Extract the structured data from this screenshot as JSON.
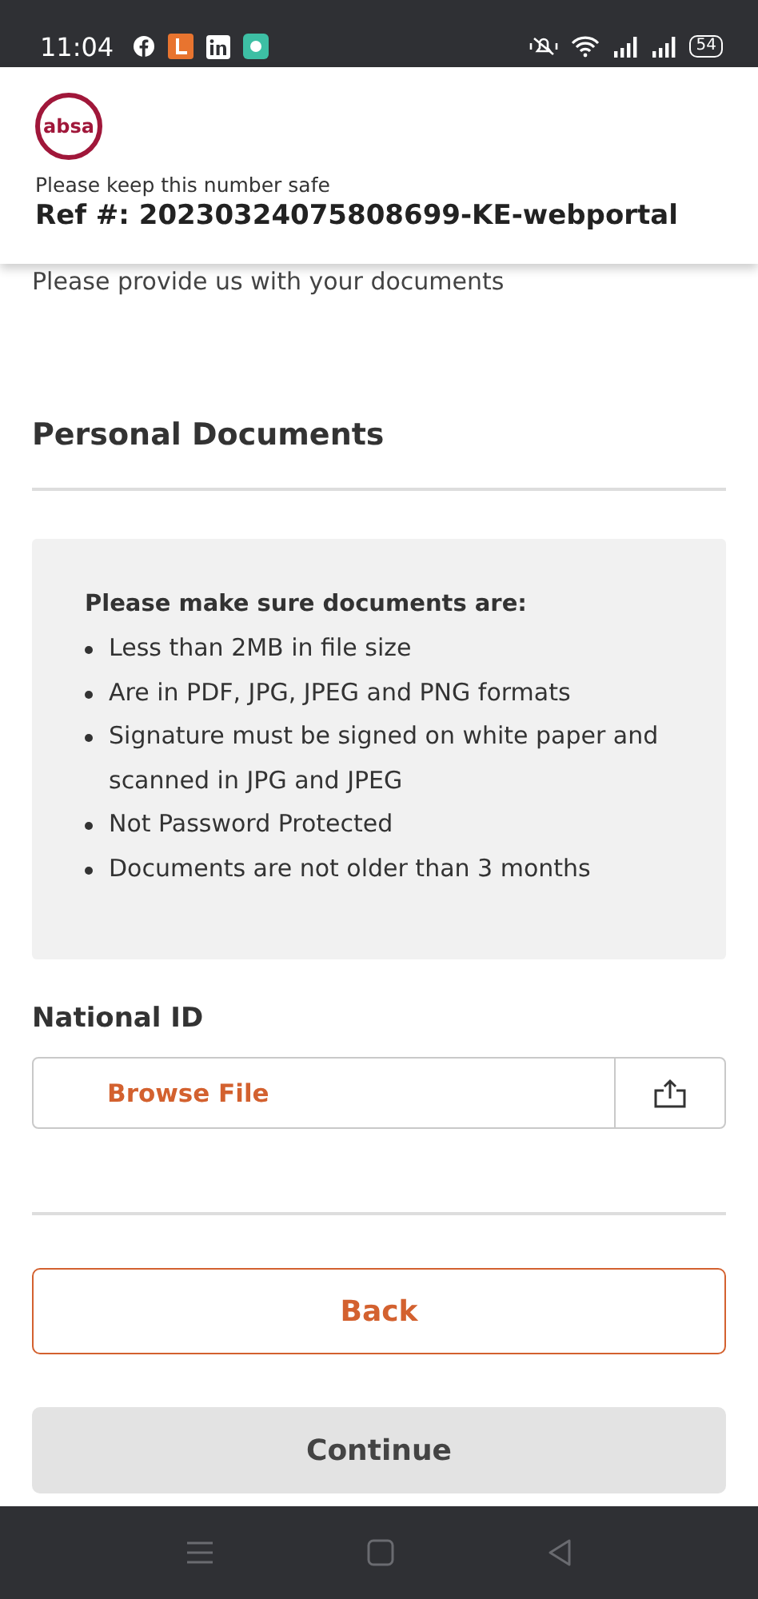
{
  "status_bar": {
    "time": "11:04",
    "battery": "54"
  },
  "header": {
    "logo": "absa",
    "note": "Please keep this number safe",
    "reference": "Ref #: 20230324075808699-KE-webportal"
  },
  "intro": "Please provide us with your documents",
  "section_title": "Personal Documents",
  "requirements": {
    "title": "Please make sure documents are:",
    "items": [
      "Less than 2MB in file size",
      "Are in PDF, JPG, JPEG and PNG formats",
      "Signature must be signed on white paper and scanned in JPG and JPEG",
      "Not Password Protected",
      "Documents are not older than 3 months"
    ]
  },
  "upload": {
    "label": "National ID",
    "button": "Browse File"
  },
  "buttons": [
    {
      "label": "Back",
      "kind": "outline",
      "disabled": false
    },
    {
      "label": "Continue",
      "kind": "filled",
      "disabled": true
    }
  ]
}
